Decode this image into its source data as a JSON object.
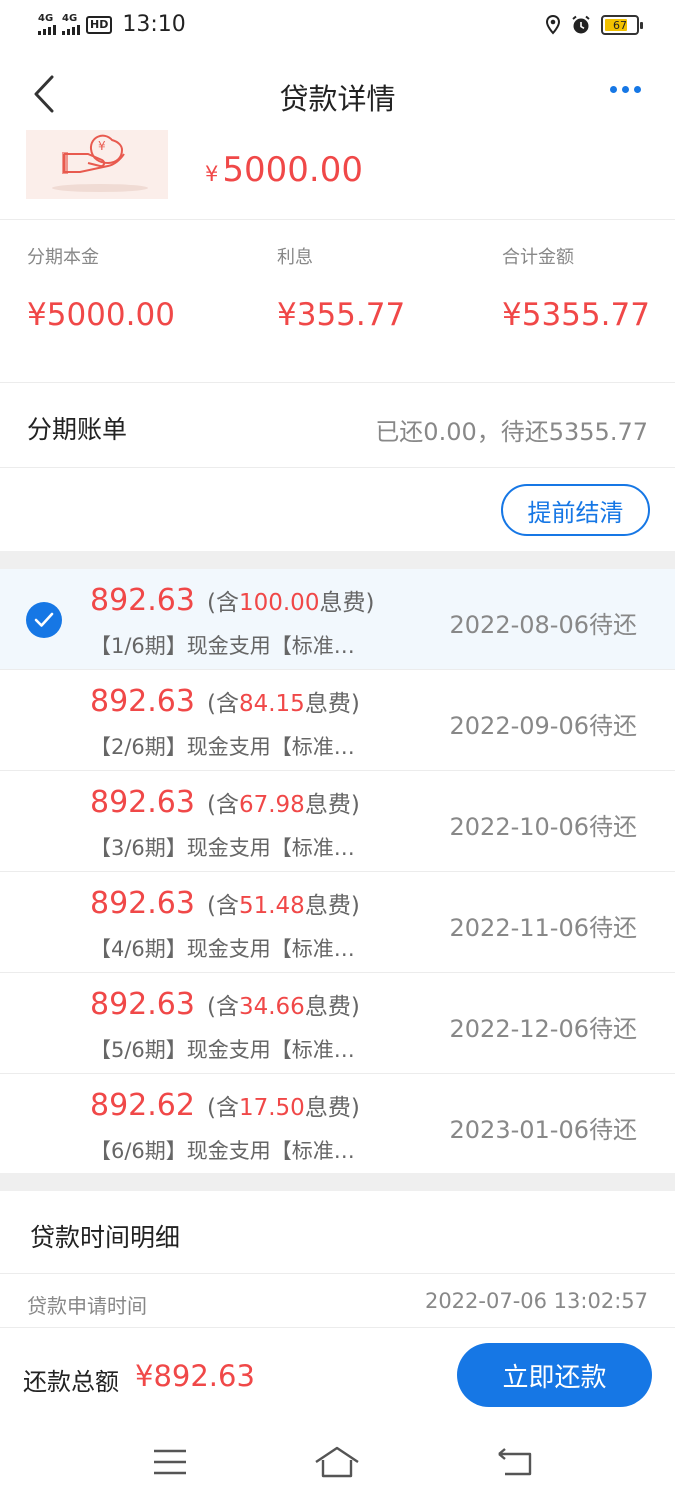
{
  "status_bar": {
    "sim1": "4G",
    "sim2": "4G",
    "hd": "HD",
    "time": "13:10",
    "battery": "67"
  },
  "nav": {
    "title": "贷款详情",
    "back_icon": "chevron-left-icon",
    "more_icon": "more-dots-icon"
  },
  "loan": {
    "currency": "¥",
    "amount": "5000.00"
  },
  "summary": {
    "principal_label": "分期本金",
    "principal_value": "¥5000.00",
    "interest_label": "利息",
    "interest_value": "¥355.77",
    "total_label": "合计金额",
    "total_value": "¥5355.77"
  },
  "bill": {
    "title": "分期账单",
    "status": "已还0.00，待还5355.77",
    "prepay_label": "提前结清"
  },
  "installments": [
    {
      "amount": "892.63",
      "fee_prefix": "(含",
      "fee": "100.00",
      "fee_suffix": "息费)",
      "desc": "【1/6期】现金支用【标准…",
      "due": "2022-08-06待还",
      "selected": true
    },
    {
      "amount": "892.63",
      "fee_prefix": "(含",
      "fee": "84.15",
      "fee_suffix": "息费)",
      "desc": "【2/6期】现金支用【标准…",
      "due": "2022-09-06待还",
      "selected": false
    },
    {
      "amount": "892.63",
      "fee_prefix": "(含",
      "fee": "67.98",
      "fee_suffix": "息费)",
      "desc": "【3/6期】现金支用【标准…",
      "due": "2022-10-06待还",
      "selected": false
    },
    {
      "amount": "892.63",
      "fee_prefix": "(含",
      "fee": "51.48",
      "fee_suffix": "息费)",
      "desc": "【4/6期】现金支用【标准…",
      "due": "2022-11-06待还",
      "selected": false
    },
    {
      "amount": "892.63",
      "fee_prefix": "(含",
      "fee": "34.66",
      "fee_suffix": "息费)",
      "desc": "【5/6期】现金支用【标准…",
      "due": "2022-12-06待还",
      "selected": false
    },
    {
      "amount": "892.62",
      "fee_prefix": "(含",
      "fee": "17.50",
      "fee_suffix": "息费)",
      "desc": "【6/6期】现金支用【标准…",
      "due": "2023-01-06待还",
      "selected": false
    }
  ],
  "time_detail": {
    "title": "贷款时间明细",
    "apply_label": "贷款申请时间",
    "apply_value": "2022-07-06  13:02:57"
  },
  "footer": {
    "total_label": "还款总额",
    "total_value": "¥892.63",
    "pay_label": "立即还款"
  },
  "colors": {
    "accent": "#1677e5",
    "amount_red": "#f04848",
    "selected_row_bg": "#f2f8fd"
  }
}
